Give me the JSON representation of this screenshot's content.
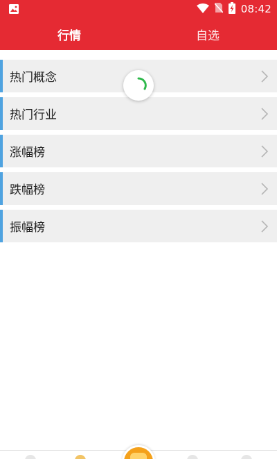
{
  "status_bar": {
    "time": "08:42",
    "icons": [
      "image-icon",
      "wifi-icon",
      "no-sim-icon",
      "battery-charging-icon"
    ]
  },
  "tabs": [
    {
      "label": "行情",
      "active": true
    },
    {
      "label": "自选",
      "active": false
    }
  ],
  "list": {
    "items": [
      {
        "label": "热门概念"
      },
      {
        "label": "热门行业"
      },
      {
        "label": "涨幅榜"
      },
      {
        "label": "跌幅榜"
      },
      {
        "label": "振幅榜"
      }
    ]
  },
  "loading": {
    "visible": true
  },
  "colors": {
    "header": "#e52a33",
    "row_background": "#efefef",
    "row_accent": "#4fa3e0",
    "spinner": "#2db84a",
    "bottom_center": "#f4a11b"
  }
}
